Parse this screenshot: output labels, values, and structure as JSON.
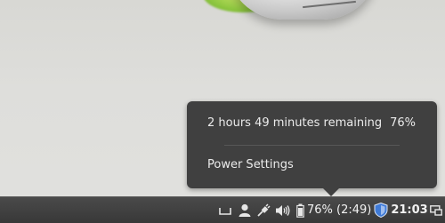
{
  "popup": {
    "battery_text": "2 hours 49 minutes remaining",
    "battery_percent": "76%",
    "power_settings_label": "Power Settings"
  },
  "panel": {
    "battery_indicator": "76% (2:49)",
    "clock": "21:03",
    "icons": [
      "keyboard-icon",
      "user-icon",
      "network-plug-icon",
      "volume-icon",
      "battery-icon",
      "shield-update-icon",
      "workspace-icon"
    ]
  },
  "colors": {
    "popup_bg": "#404040",
    "panel_bg": "#3c3c3c",
    "shield_blue": "#3f7ad6"
  }
}
